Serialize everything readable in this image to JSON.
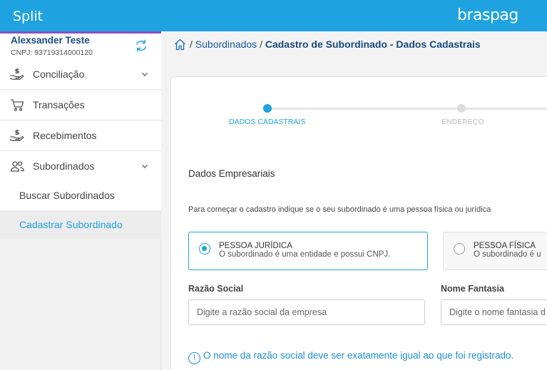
{
  "header": {
    "app_title": "Split",
    "brand": "braspag"
  },
  "user": {
    "name": "Alexsander Teste",
    "document": "CNPJ: 93719314000120"
  },
  "sidebar": {
    "items": [
      {
        "label": "Conciliação",
        "icon": "hand-coin-icon",
        "has_submenu": true
      },
      {
        "label": "Transações",
        "icon": "cart-icon",
        "has_submenu": false
      },
      {
        "label": "Recebimentos",
        "icon": "hand-coin-icon",
        "has_submenu": false
      },
      {
        "label": "Subordinados",
        "icon": "users-icon",
        "has_submenu": true
      }
    ],
    "subitems": [
      {
        "label": "Buscar Subordinados",
        "active": false
      },
      {
        "label": "Cadastrar Subordinado",
        "active": true
      }
    ]
  },
  "breadcrumb": {
    "link": "Subordinados",
    "separator": "/",
    "current": "Cadastro de Subordinado - Dados Cadastrais"
  },
  "steps": [
    {
      "label": "DADOS CADASTRAIS",
      "active": true
    },
    {
      "label": "ENDEREÇO",
      "active": false
    }
  ],
  "form": {
    "section_title": "Dados Empresariais",
    "intro": "Para começar o cadastro indique se o seu subordinado é uma pessoa física ou jurídica",
    "person_types": [
      {
        "title": "PESSOA JURÍDICA",
        "description": "O subordinado é uma entidade e possui CNPJ.",
        "selected": true
      },
      {
        "title": "PESSOA FÍSICA",
        "description": "O subordinado é u",
        "selected": false
      }
    ],
    "razao_social": {
      "label": "Razão Social",
      "placeholder": "Digite a razão social da empresa",
      "value": ""
    },
    "nome_fantasia": {
      "label": "Nome Fantasia",
      "placeholder": "Digite o nome fantasia d",
      "value": ""
    },
    "hint_icon": "!",
    "hint": "O nome da razão social deve ser exatamente igual ao que foi registrado."
  },
  "colors": {
    "primary": "#1ea3e0",
    "accent_purple": "#8a4fbf",
    "user_name": "#1a4a8a"
  }
}
